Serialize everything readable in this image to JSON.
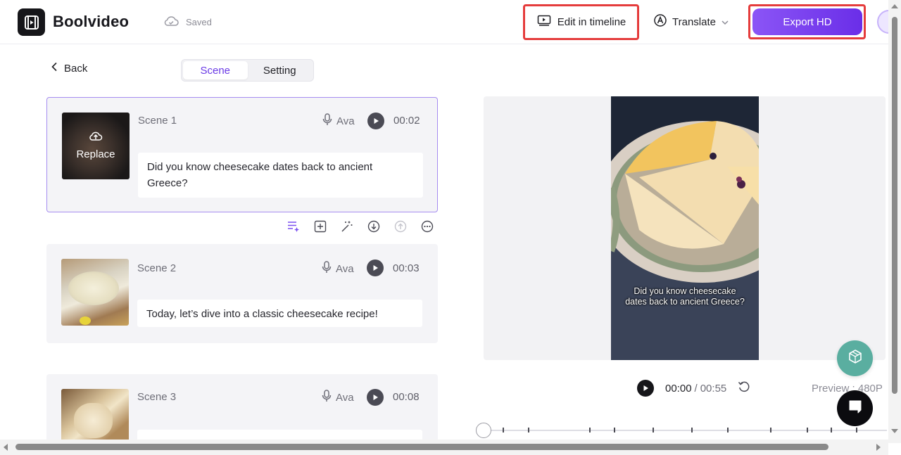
{
  "header": {
    "brand": "Boolvideo",
    "saved_label": "Saved",
    "edit_timeline_label": "Edit in timeline",
    "translate_label": "Translate",
    "export_label": "Export HD"
  },
  "nav": {
    "back_label": "Back",
    "tabs": [
      {
        "label": "Scene",
        "active": true
      },
      {
        "label": "Setting",
        "active": false
      }
    ]
  },
  "scenes": [
    {
      "title": "Scene 1",
      "voice": "Ava",
      "duration": "00:02",
      "script": "Did you know cheesecake dates back to ancient Greece?",
      "thumb_overlay": "Replace"
    },
    {
      "title": "Scene 2",
      "voice": "Ava",
      "duration": "00:03",
      "script": "Today, let’s dive into a classic cheesecake recipe!"
    },
    {
      "title": "Scene 3",
      "voice": "Ava",
      "duration": "00:08",
      "script": ""
    }
  ],
  "scene_tools": [
    "ai-script-icon",
    "add-scene-icon",
    "magic-wand-icon",
    "move-down-icon",
    "move-up-icon",
    "more-icon"
  ],
  "preview": {
    "caption": "Did you know cheesecake dates back to ancient Greece?",
    "current_time": "00:00",
    "separator": "/",
    "total_time": "00:55",
    "quality": "Preview : 480P"
  },
  "colors": {
    "accent": "#6a3ae6",
    "highlight": "#e53c3c",
    "teal_fab": "#5aaea0"
  }
}
